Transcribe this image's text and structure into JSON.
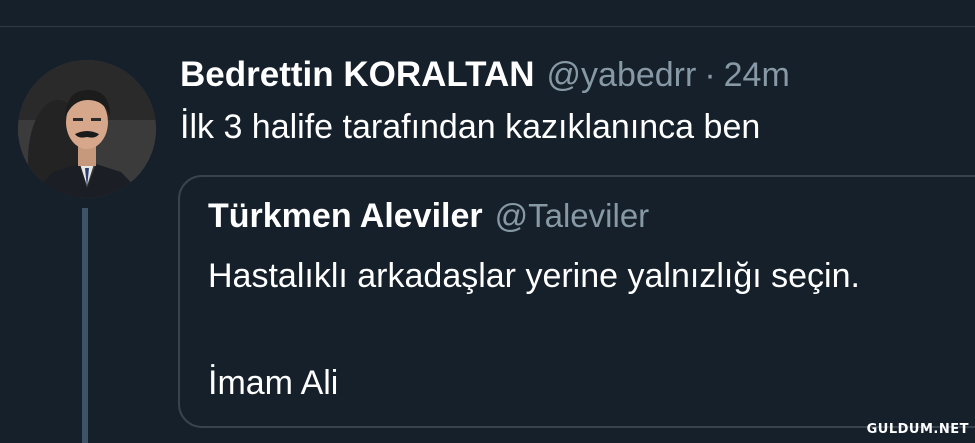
{
  "tweet": {
    "author_name": "Bedrettin KORALTAN",
    "author_handle": "@yabedrr",
    "separator": "·",
    "time_ago": "24m",
    "text": "İlk 3 halife tarafından kazıklanınca ben",
    "avatar": "profile-photo"
  },
  "quote": {
    "author_name": "Türkmen Aleviler",
    "author_handle": "@Taleviler",
    "lines": [
      "Hastalıklı arkadaşlar yerine yalnızlığı seçin.",
      "İmam Ali"
    ]
  },
  "watermark": "GULDUM.NET",
  "colors": {
    "background": "#15202b",
    "text_primary": "#ffffff",
    "text_secondary": "#8899a6",
    "border": "#38444d",
    "thread_line": "#3d5466"
  }
}
